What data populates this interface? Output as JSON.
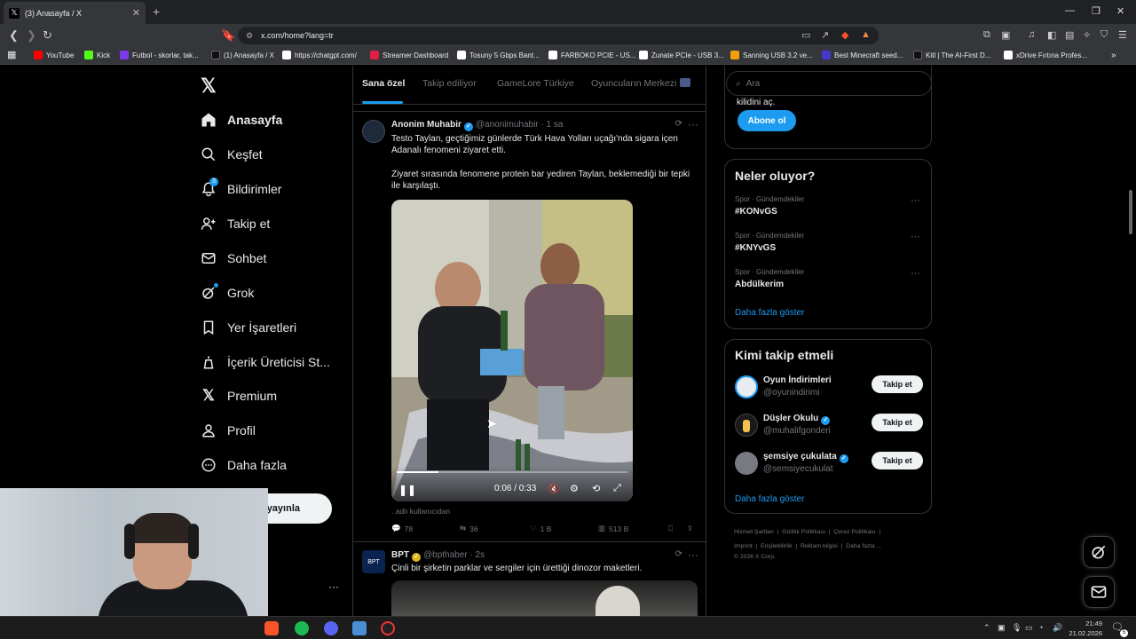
{
  "browser": {
    "tab_title": "(3) Anasayfa / X",
    "url": "x.com/home?lang=tr",
    "bookmarks": [
      {
        "label": "YouTube",
        "color": "#ff0000"
      },
      {
        "label": "Kick",
        "color": "#53fc18"
      },
      {
        "label": "Futbol - skorlar, tak...",
        "color": "#7c3aed"
      },
      {
        "label": "(1) Anasayfa / X",
        "color": "#000000"
      },
      {
        "label": "https://chatgpt.com/",
        "color": "#ffffff"
      },
      {
        "label": "Streamer Dashboard",
        "color": "#e11d48"
      },
      {
        "label": "Tosuny 5 Gbps Bant...",
        "color": "#ffffff"
      },
      {
        "label": "FARBOKO PCIE - US...",
        "color": "#ffffff"
      },
      {
        "label": "Zunate PCIe - USB 3...",
        "color": "#ffffff"
      },
      {
        "label": "Sanning USB 3.2 ve...",
        "color": "#f59e0b"
      },
      {
        "label": "Best Minecraft seed...",
        "color": "#4338ca"
      },
      {
        "label": "Kitl | The AI-First D...",
        "color": "#000000"
      },
      {
        "label": "xDrive Fırtına Profes...",
        "color": "#ffffff"
      }
    ]
  },
  "nav": {
    "items": [
      {
        "label": "Anasayfa"
      },
      {
        "label": "Keşfet"
      },
      {
        "label": "Bildirimler",
        "badge": "3"
      },
      {
        "label": "Takip et"
      },
      {
        "label": "Sohbet"
      },
      {
        "label": "Grok"
      },
      {
        "label": "Yer İşaretleri"
      },
      {
        "label": "İçerik Üreticisi St..."
      },
      {
        "label": "Premium"
      },
      {
        "label": "Profil"
      },
      {
        "label": "Daha fazla"
      }
    ],
    "post_button": "yayınla"
  },
  "timeline": {
    "tabs": [
      "Sana özel",
      "Takip ediliyor",
      "GameLore Türkiye",
      "Oyuncuların Merkezi"
    ],
    "tweets": [
      {
        "name": "Anonim Muhabir",
        "handle": "@anonimuhabir",
        "time": "· 1 sa",
        "text1": "Testo Taylan, geçtiğimiz günlerde Türk Hava Yolları uçağı'nda sigara içen Adanalı fenomeni ziyaret etti.",
        "text2": "Ziyaret sırasında fenomene protein bar yediren Taylan, beklemediği bir tepki ile karşılaştı.",
        "video_time": "0:06 / 0:33",
        "video_progress": 0.18,
        "source": ". adlı kullanıcıdan",
        "replies": "78",
        "reposts": "36",
        "likes": "1 B",
        "views": "513 B"
      },
      {
        "name": "BPT",
        "handle": "@bpthaber",
        "time": "· 2s",
        "text1": "Çinli bir şirketin parklar ve sergiler için ürettiği dinozor maketleri."
      }
    ]
  },
  "sidebar": {
    "search_placeholder": "Ara",
    "premium_text": "kilidini aç.",
    "subscribe_button": "Abone ol",
    "trends_title": "Neler oluyor?",
    "trends": [
      {
        "category": "Spor · Gündemdekiler",
        "name": "#KONvGS"
      },
      {
        "category": "Spor · Gündemdekiler",
        "name": "#KNYvGS"
      },
      {
        "category": "Spor · Gündemdekiler",
        "name": "Abdülkerim"
      }
    ],
    "show_more": "Daha fazla göster",
    "who_title": "Kimi takip etmeli",
    "who": [
      {
        "name": "Oyun İndirimleri",
        "handle": "@oyunindirimi",
        "follow": "Takip et",
        "verified": false
      },
      {
        "name": "Düşler Okulu",
        "handle": "@muhalifgonderi",
        "follow": "Takip et",
        "verified": true
      },
      {
        "name": "şemsiye çukulata",
        "handle": "@semsiyecukulat",
        "follow": "Takip et",
        "verified": true
      }
    ],
    "who_more": "Daha fazla göster",
    "footer": {
      "links": [
        "Hizmet Şartları",
        "Gizlilik Politikası",
        "Çerez Politikası",
        "Imprint",
        "Erişilebilirlik",
        "Reklam bilgisi",
        "Daha fazla ..."
      ],
      "copyright": "© 2026 X Corp."
    }
  },
  "taskbar": {
    "time": "21:49",
    "date": "21.02.2026",
    "notif_count": "5"
  }
}
